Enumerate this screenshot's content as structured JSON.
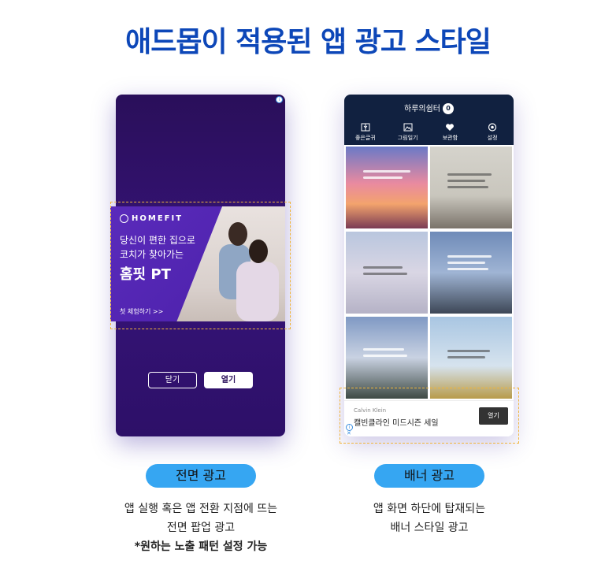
{
  "page": {
    "title": "애드몹이 적용된 앱 광고 스타일"
  },
  "interstitial": {
    "ad": {
      "brand": "HOMEFIT",
      "line1": "당신이 편한 집으로",
      "line2": "코치가 찾아가는",
      "headline": "홈핏 PT",
      "cta": "첫 체험하기 >>"
    },
    "close_label": "닫기",
    "open_label": "열기",
    "adchoice_icon": "info-icon"
  },
  "app": {
    "title": "하루의쉼터",
    "badge": "0",
    "nav": [
      {
        "label": "좋은글귀",
        "icon": "book-icon"
      },
      {
        "label": "그림일기",
        "icon": "image-icon"
      },
      {
        "label": "보관함",
        "icon": "heart-icon"
      },
      {
        "label": "설정",
        "icon": "gear-icon"
      }
    ],
    "banner": {
      "brand": "Calvin Klein",
      "text": "캘빈클라인 미드시즌 세일",
      "button": "열기"
    }
  },
  "labels": {
    "interstitial_pill": "전면 광고",
    "interstitial_desc_1": "앱 실행 혹은 앱 전환 지점에 뜨는",
    "interstitial_desc_2": "전면 팝업 광고",
    "interstitial_desc_3": "*원하는 노출 패턴 설정 가능",
    "banner_pill": "배너 광고",
    "banner_desc_1": "앱 화면 하단에 탑재되는",
    "banner_desc_2": "배너 스타일 광고"
  },
  "colors": {
    "title": "#0d47b8",
    "pill": "#36a6f2",
    "interstitial_bg": "#361378",
    "app_header": "#112140",
    "dash": "#f0b43a"
  }
}
